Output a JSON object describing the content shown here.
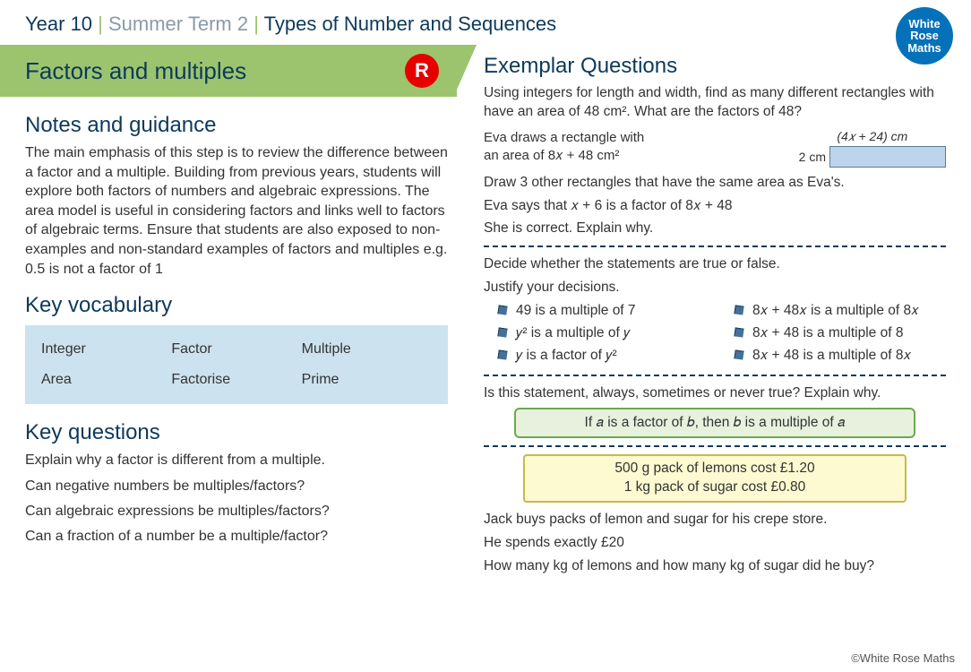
{
  "breadcrumb": {
    "year": "Year 10",
    "term": "Summer Term 2",
    "topic": "Types of Number and Sequences"
  },
  "logo": {
    "line1": "White",
    "line2": "Rose",
    "line3": "Maths"
  },
  "title": "Factors and multiples",
  "badge": "R",
  "headings": {
    "notes": "Notes and guidance",
    "vocab": "Key vocabulary",
    "kq": "Key questions",
    "exemplar": "Exemplar Questions"
  },
  "notes_text": "The main emphasis of this step is to review the difference between a factor and a multiple. Building from previous years, students will explore both factors of numbers and algebraic expressions. The area model is useful in considering factors and links well to factors of algebraic terms. Ensure that students are also exposed to non-examples and non-standard examples of factors and multiples e.g. 0.5 is not a factor of 1",
  "vocab": [
    [
      "Integer",
      "Factor",
      "Multiple"
    ],
    [
      "Area",
      "Factorise",
      "Prime"
    ]
  ],
  "key_questions": [
    "Explain why a factor is different from a multiple.",
    "Can negative numbers be multiples/factors?",
    "Can algebraic expressions be multiples/factors?",
    "Can a fraction of a number be a multiple/factor?"
  ],
  "exemplar": {
    "intro": "Using integers for length and width, find as many different rectangles with have an area of 48 cm².  What are the factors of 48?",
    "eva_text_1": "Eva draws a rectangle with",
    "eva_text_2": "an area of 8𝑥 + 48 cm²",
    "rect_top": "(4𝑥 + 24) cm",
    "rect_side": "2 cm",
    "eva_block_1": "Draw 3 other rectangles that have the same area as Eva's.",
    "eva_block_2": "Eva says that 𝑥 + 6 is a factor of 8𝑥 + 48",
    "eva_block_3": "She is correct.  Explain why.",
    "tf_intro_1": "Decide whether the statements are true or false.",
    "tf_intro_2": "Justify your decisions.",
    "tf_left": [
      "49 is a multiple of 7",
      "𝑦² is a multiple of 𝑦",
      "𝑦 is a factor of 𝑦²"
    ],
    "tf_right": [
      "8𝑥 + 48𝑥 is a multiple of 8𝑥",
      "8𝑥 + 48 is a multiple of 8",
      "8𝑥 + 48 is a multiple of 8𝑥"
    ],
    "asn_intro": "Is this statement, always, sometimes or never true?  Explain why.",
    "green_box": "If 𝑎 is a factor of 𝑏, then 𝑏 is a multiple of 𝑎",
    "yellow_line_1": "500 g pack of lemons cost £1.20",
    "yellow_line_2": "1 kg pack of sugar cost £0.80",
    "jack_1": "Jack buys packs of lemon and sugar for his crepe store.",
    "jack_2": "He spends exactly £20",
    "jack_3": "How many kg of lemons and how many kg of sugar did he buy?"
  },
  "footer": "©White Rose Maths"
}
